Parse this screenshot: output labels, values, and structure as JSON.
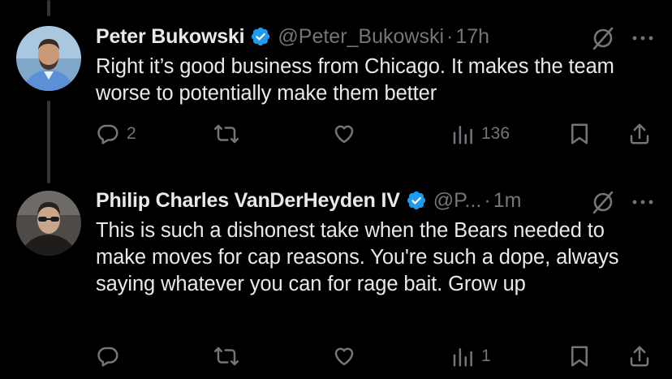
{
  "colors": {
    "background": "#000000",
    "text": "#e7e9ea",
    "secondary": "#71767b",
    "verified_badge": "#1d9bf0",
    "thread_line": "#333639"
  },
  "tweets": [
    {
      "author_name": "Peter Bukowski",
      "handle": "@Peter_Bukowski",
      "separator": "·",
      "time": "17h",
      "text": "Right it’s good business from Chicago. It makes the team worse to potentially make them better",
      "reply_count": "2",
      "retweet_count": "",
      "like_count": "",
      "view_count": "136",
      "icons": [
        "verified-badge-icon",
        "grok-icon",
        "more-icon",
        "reply-icon",
        "retweet-icon",
        "like-icon",
        "views-icon",
        "bookmark-icon",
        "share-icon"
      ]
    },
    {
      "author_name": "Philip Charles VanDerHeyden IV",
      "handle": "@P...",
      "separator": "·",
      "time": "1m",
      "text": "This is such a dishonest take when the Bears needed to make moves for cap reasons. You're such a dope, always saying whatever you can for rage bait. Grow up",
      "reply_count": "",
      "retweet_count": "",
      "like_count": "",
      "view_count": "1",
      "icons": [
        "verified-badge-icon",
        "grok-icon",
        "more-icon",
        "reply-icon",
        "retweet-icon",
        "like-icon",
        "views-icon",
        "bookmark-icon",
        "share-icon"
      ]
    }
  ]
}
